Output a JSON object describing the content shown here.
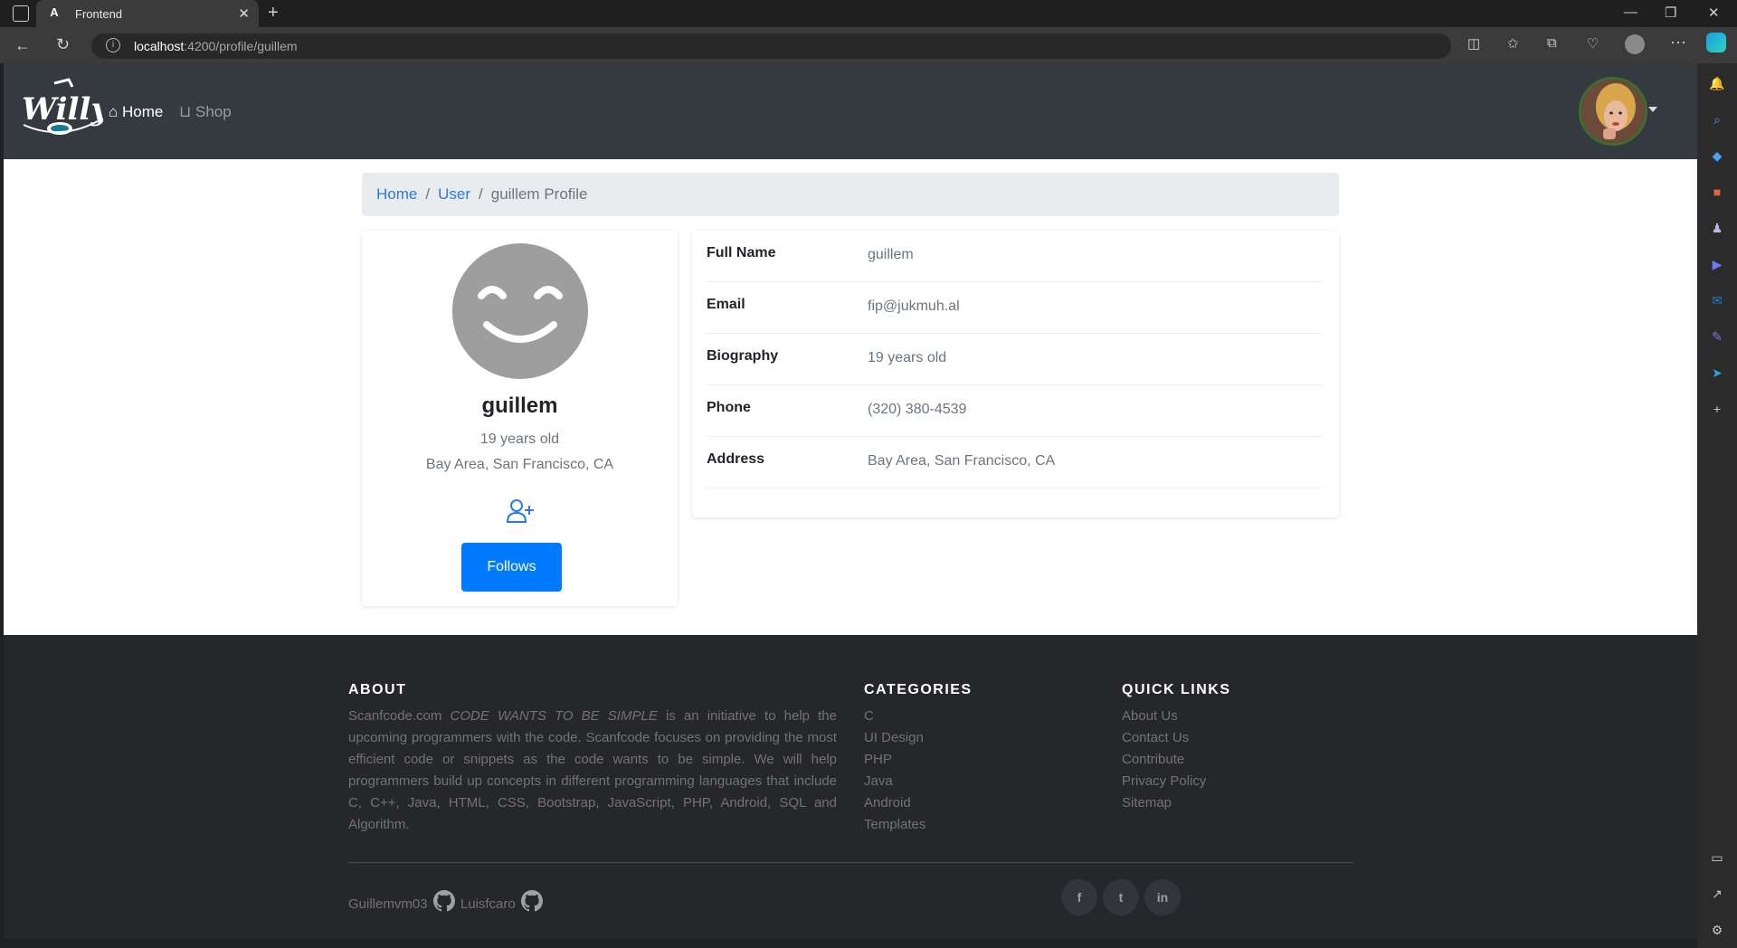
{
  "browser": {
    "tab_title": "Frontend",
    "url_host": "localhost",
    "url_path": ":4200/profile/guillem"
  },
  "navbar": {
    "home_label": "Home",
    "shop_label": "Shop",
    "logo_text": "Willy"
  },
  "breadcrumb": {
    "home": "Home",
    "user": "User",
    "current": "guillem Profile"
  },
  "profile": {
    "name": "guillem",
    "bio": "19 years old",
    "address": "Bay Area, San Francisco, CA",
    "follow_label": "Follows"
  },
  "details": [
    {
      "label": "Full Name",
      "value": "guillem"
    },
    {
      "label": "Email",
      "value": "fip@jukmuh.al"
    },
    {
      "label": "Biography",
      "value": "19 years old"
    },
    {
      "label": "Phone",
      "value": "(320) 380-4539"
    },
    {
      "label": "Address",
      "value": "Bay Area, San Francisco, CA"
    }
  ],
  "footer": {
    "about_heading": "ABOUT",
    "about_prefix": "Scanfcode.com ",
    "about_italic": "CODE WANTS TO BE SIMPLE",
    "about_rest": " is an initiative to help the upcoming programmers with the code. Scanfcode focuses on providing the most efficient code or snippets as the code wants to be simple. We will help programmers build up concepts in different programming languages that include C, C++, Java, HTML, CSS, Bootstrap, JavaScript, PHP, Android, SQL and Algorithm.",
    "categories_heading": "CATEGORIES",
    "categories": [
      "C",
      "UI Design",
      "PHP",
      "Java",
      "Android",
      "Templates"
    ],
    "quicklinks_heading": "QUICK LINKS",
    "quicklinks": [
      "About Us",
      "Contact Us",
      "Contribute",
      "Privacy Policy",
      "Sitemap"
    ],
    "credit1": "Guillemvm03",
    "credit2": "Luisfcaro"
  },
  "colors": {
    "navbar_bg": "#343a40",
    "footer_bg": "#26272b",
    "primary": "#007bff",
    "link": "#2a7ae2"
  }
}
